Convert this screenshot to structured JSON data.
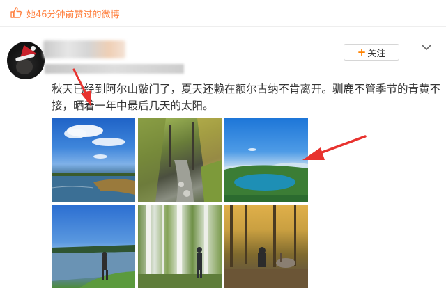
{
  "like_bar": {
    "text": "她46分钟前赞过的微博"
  },
  "post": {
    "follow_label": "关注",
    "follow_plus": "+",
    "text": "秋天已经到阿尔山敲门了，夏天还赖在额尔古纳不肯离开。驯鹿不管季节的青黄不接，晒着一年中最后几天的太阳。"
  },
  "colors": {
    "accent": "#ff8140",
    "follow_plus": "#ff8200",
    "annotation_arrow": "#e8322e"
  }
}
